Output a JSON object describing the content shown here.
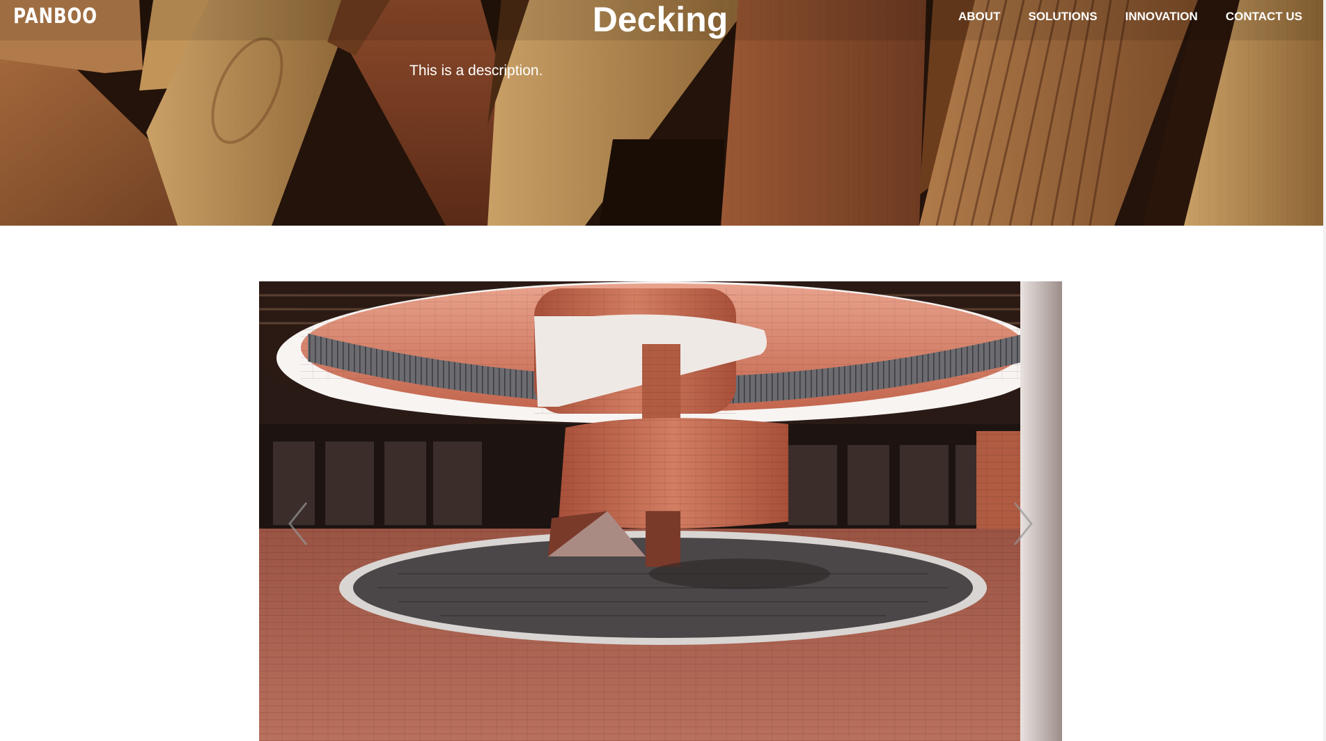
{
  "header": {
    "logo_text": "PANBOO",
    "title": "Decking",
    "description": "This is a description.",
    "nav": [
      {
        "label": "ABOUT"
      },
      {
        "label": "SOLUTIONS"
      },
      {
        "label": "INNOVATION"
      },
      {
        "label": "CONTACT US"
      }
    ]
  },
  "carousel": {
    "previous_icon": "chevron-left-icon",
    "next_icon": "chevron-right-icon"
  },
  "colors": {
    "wood_dark": "#2a160c",
    "wood_mid": "#8a4a2c",
    "wood_light": "#b78648",
    "brick": "#b7624b",
    "text_light": "#ffffff"
  }
}
